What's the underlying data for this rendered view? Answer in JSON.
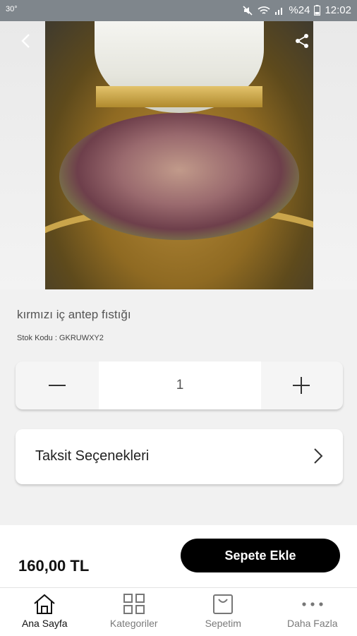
{
  "status_bar": {
    "temperature": "30°",
    "battery": "%24",
    "time": "12:02"
  },
  "product": {
    "name": "kırmızı iç antep fıstığı",
    "stock_code": "Stok Kodu : GKRUWXY2",
    "quantity": "1",
    "installment_label": "Taksit Seçenekleri",
    "price": "160,00 TL",
    "add_to_cart_label": "Sepete Ekle"
  },
  "bottom_nav": {
    "items": [
      {
        "label": "Ana Sayfa",
        "icon": "home-icon",
        "active": true
      },
      {
        "label": "Kategoriler",
        "icon": "grid-icon"
      },
      {
        "label": "Sepetim",
        "icon": "shopping-bag-icon"
      },
      {
        "label": "Daha Fazla",
        "icon": "more-dots-icon"
      }
    ]
  },
  "colors": {
    "primary": "#000000",
    "background": "#f1f1f1",
    "status_bar": "#7f868c"
  }
}
